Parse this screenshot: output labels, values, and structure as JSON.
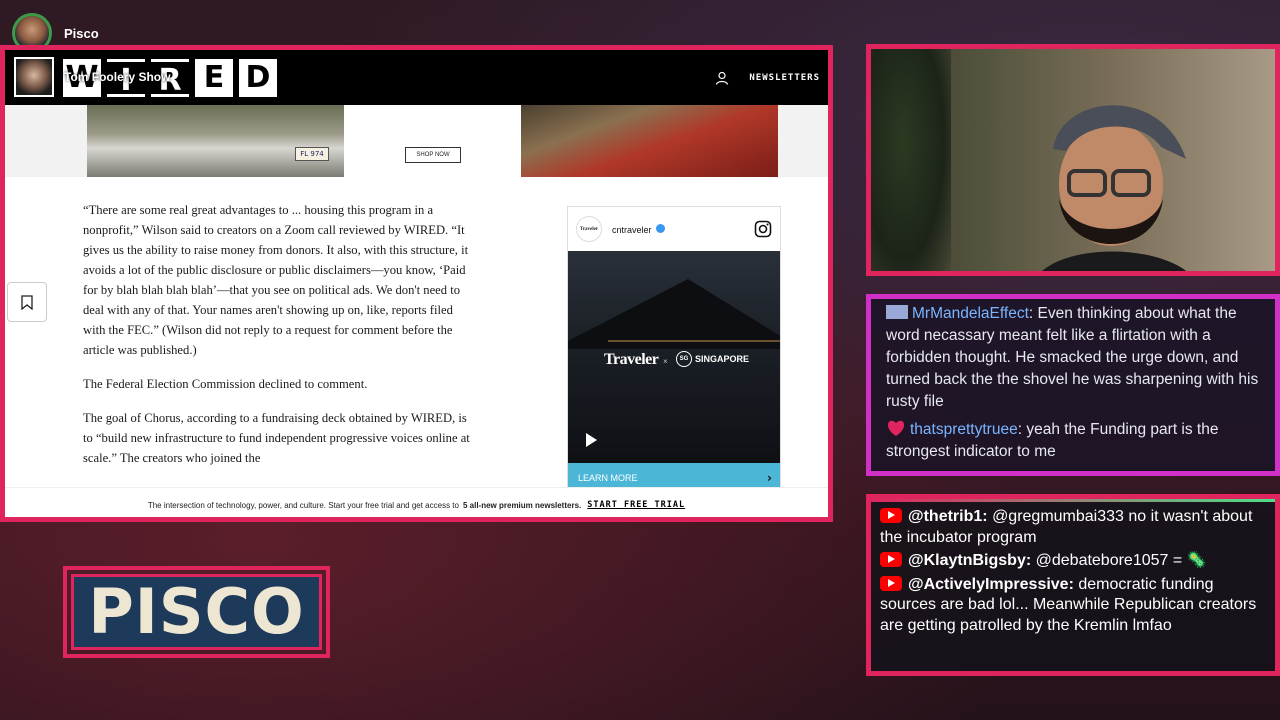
{
  "streamer": {
    "name": "Pisco"
  },
  "browser": {
    "overlay_show": "Tom Foolery Show",
    "header": {
      "logo_letters": [
        "W",
        "I",
        "R",
        "E",
        "D"
      ],
      "newsletters": "NEWSLETTERS"
    },
    "ad": {
      "shop_now": "SHOP NOW",
      "plate": "FL 974"
    },
    "article": {
      "paragraphs": [
        "“There are some real great advantages to ... housing this program in a nonprofit,” Wilson said to creators on a Zoom call reviewed by WIRED. “It gives us the ability to raise money from donors. It also, with this structure, it avoids a lot of the public disclosure or public disclaimers—you know, ‘Paid for by blah blah blah blah’—that you see on political ads. We don't need to deal with any of that. Your names aren't showing up on, like, reports filed with the FEC.” (Wilson did not reply to a request for comment before the article was published.)",
        "The Federal Election Commission declined to comment.",
        "The goal of Chorus, according to a fundraising deck obtained by WIRED, is to “build new infrastructure to fund independent progressive voices online at scale.” The creators who joined the"
      ]
    },
    "instagram_card": {
      "mini_logo": "Traveler",
      "handle": "cntraveler",
      "brand_a": "Traveler",
      "separator": "×",
      "brand_b": "SINGAPORE",
      "brand_b_badge": "SG",
      "learn_more": "LEARN MORE"
    },
    "paywall": {
      "text": "The intersection of technology, power, and culture. Start your free trial and get access to",
      "bold": "5 all-new premium newsletters.",
      "cta": "START FREE TRIAL"
    }
  },
  "chat_top": {
    "messages": [
      {
        "user": "MrMandelaEffect",
        "text": "Even thinking about what the word necassary meant felt like a flirtation with a forbidden thought. He smacked the urge down, and turned back the the shovel he was sharpening with his rusty file"
      },
      {
        "user": "thatsprettytruee",
        "text": "yeah the Funding part is the strongest indicator to me"
      }
    ]
  },
  "chat_bottom": {
    "messages": [
      {
        "user": "@thetrib1:",
        "text": "@gregmumbai333 no it wasn't about the incubator program"
      },
      {
        "user": "@KlaytnBigsby:",
        "text": "@debatebore1057 = 🦠"
      },
      {
        "user": "@ActivelyImpressive:",
        "text": "democratic funding sources are bad lol... Meanwhile Republican creators are getting patrolled by the Kremlin lmfao"
      }
    ]
  },
  "name_plate": {
    "text": "PISCO"
  },
  "colors": {
    "frame": "#e0245e",
    "chat_frame": "#d030c8",
    "youtube": "#ff0000",
    "plate_bg": "#1e3a5a"
  }
}
